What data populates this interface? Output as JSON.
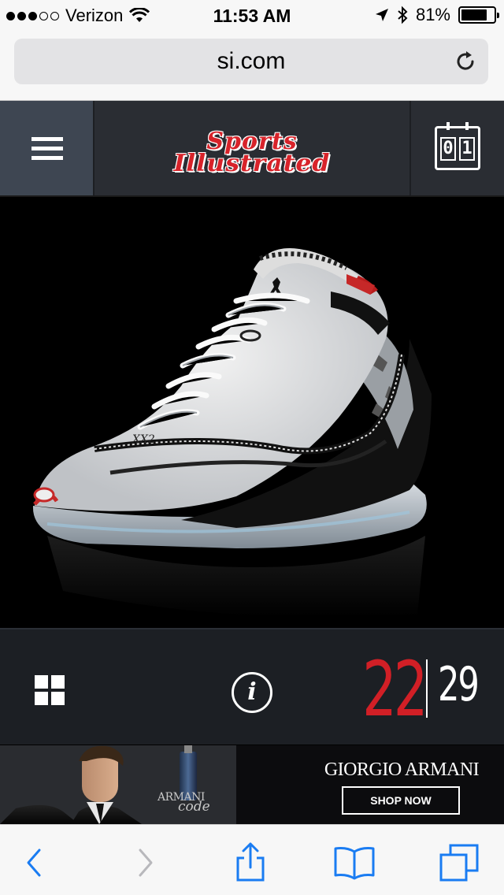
{
  "status_bar": {
    "carrier": "Verizon",
    "signal_bars_filled": 3,
    "signal_bars_total": 5,
    "time": "11:53 AM",
    "battery_percent_label": "81%",
    "battery_level": 0.81
  },
  "browser": {
    "url": "si.com"
  },
  "header": {
    "logo_line1": "Sports",
    "logo_line2": "Illustrated",
    "issue_digit_1": "0",
    "issue_digit_2": "1"
  },
  "gallery": {
    "current": "22",
    "total": "29"
  },
  "ad": {
    "product_line1": "ARMANI",
    "product_line2": "code",
    "brand": "GIORGIO ARMANI",
    "cta": "SHOP NOW"
  },
  "icons": {
    "menu": "hamburger-icon",
    "issue": "calendar-icon",
    "grid": "grid-icon",
    "info": "info-icon",
    "reload": "reload-icon",
    "back": "back-chevron-icon",
    "forward": "forward-chevron-icon",
    "share": "share-icon",
    "bookmarks": "bookmarks-icon",
    "tabs": "tabs-icon"
  },
  "colors": {
    "ios_blue": "#1a7cf2",
    "si_red": "#d8232a",
    "header_bg": "#2a2d33",
    "gallery_bg": "#1c1f24"
  }
}
